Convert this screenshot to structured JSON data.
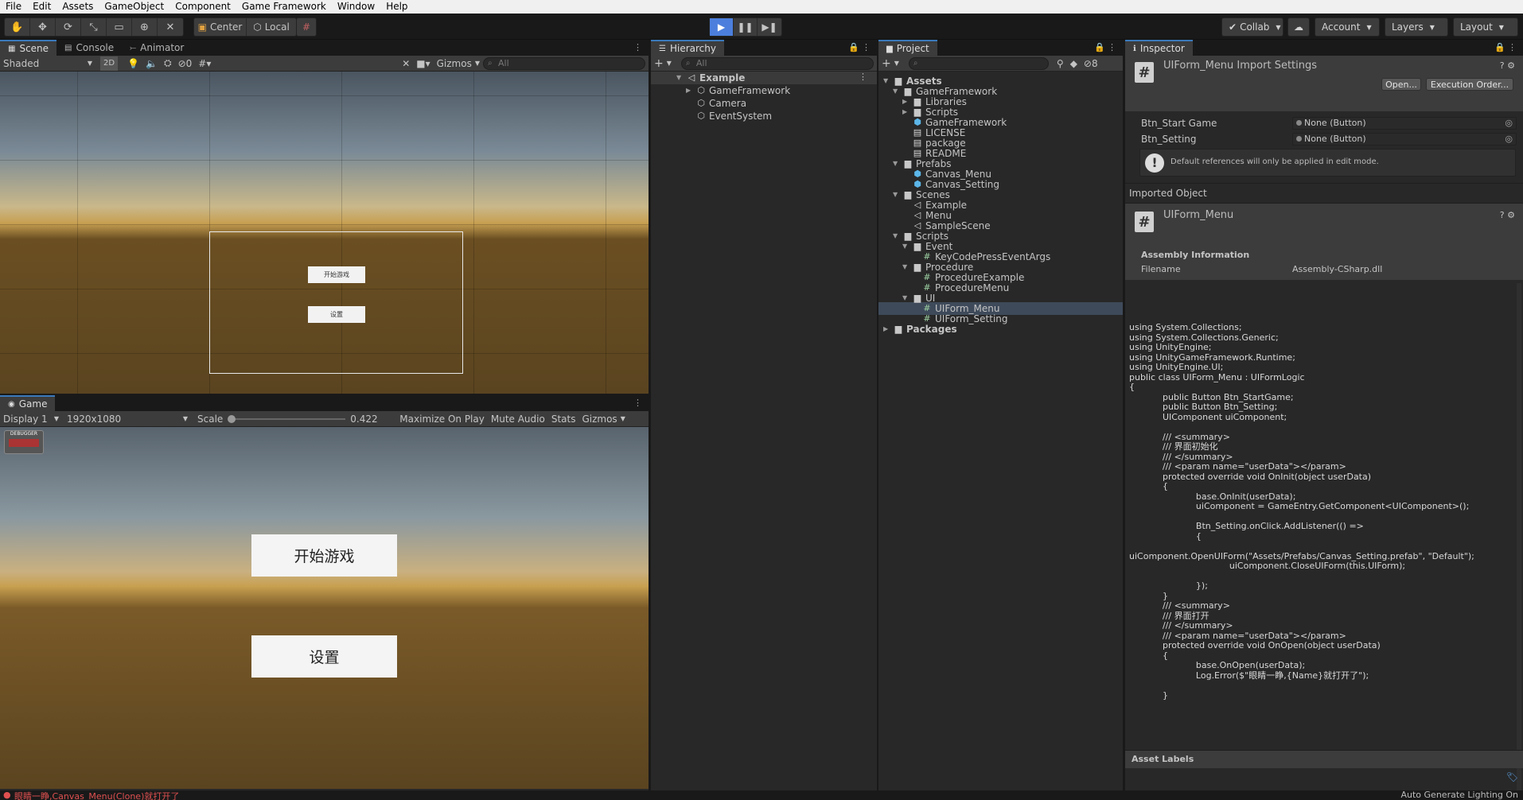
{
  "menu": [
    "File",
    "Edit",
    "Assets",
    "GameObject",
    "Component",
    "Game Framework",
    "Window",
    "Help"
  ],
  "toolbar": {
    "pivot_center": "Center",
    "pivot_local": "Local",
    "collab": "Collab",
    "account": "Account",
    "layers": "Layers",
    "layout": "Layout"
  },
  "scene_panel": {
    "tabs": [
      "Scene",
      "Console",
      "Animator"
    ],
    "shading": "Shaded",
    "mode_2d": "2D",
    "hidden_count": "0",
    "gizmos": "Gizmos",
    "search_placeholder": "All",
    "btn_start_small": "开始游戏",
    "btn_setting_small": "设置"
  },
  "game_panel": {
    "tab": "Game",
    "display": "Display 1",
    "resolution": "1920x1080",
    "scale_label": "Scale",
    "scale_value": "0.422",
    "maximize": "Maximize On Play",
    "mute": "Mute Audio",
    "stats": "Stats",
    "gizmos": "Gizmos",
    "btn_start": "开始游戏",
    "btn_setting": "设置",
    "debugger_label": "DEBUGGER"
  },
  "hierarchy": {
    "tab": "Hierarchy",
    "search_placeholder": "All",
    "scene": "Example",
    "items": [
      "GameFramework",
      "Camera",
      "EventSystem"
    ]
  },
  "project": {
    "tab": "Project",
    "hidden_count": "8",
    "tree": [
      {
        "label": "Assets",
        "bold": true
      },
      {
        "label": "GameFramework"
      },
      {
        "label": "Libraries"
      },
      {
        "label": "Scripts"
      },
      {
        "label": "GameFramework"
      },
      {
        "label": "LICENSE"
      },
      {
        "label": "package"
      },
      {
        "label": "README"
      },
      {
        "label": "Prefabs"
      },
      {
        "label": "Canvas_Menu"
      },
      {
        "label": "Canvas_Setting"
      },
      {
        "label": "Scenes"
      },
      {
        "label": "Example"
      },
      {
        "label": "Menu"
      },
      {
        "label": "SampleScene"
      },
      {
        "label": "Scripts"
      },
      {
        "label": "Event"
      },
      {
        "label": "KeyCodePressEventArgs"
      },
      {
        "label": "Procedure"
      },
      {
        "label": "ProcedureExample"
      },
      {
        "label": "ProcedureMenu"
      },
      {
        "label": "UI"
      },
      {
        "label": "UIForm_Menu",
        "selected": true
      },
      {
        "label": "UIForm_Setting"
      },
      {
        "label": "Packages",
        "bold": true
      }
    ]
  },
  "inspector": {
    "tab": "Inspector",
    "title": "UIForm_Menu Import Settings",
    "open_btn": "Open...",
    "exec_order_btn": "Execution Order...",
    "fields": [
      {
        "label": "Btn_Start Game",
        "value": "None (Button)"
      },
      {
        "label": "Btn_Setting",
        "value": "None (Button)"
      }
    ],
    "help_text": "Default references will only be applied in edit mode.",
    "imported_object": "Imported Object",
    "object_name": "UIForm_Menu",
    "assembly_info": "Assembly Information",
    "filename_label": "Filename",
    "filename_value": "Assembly-CSharp.dll",
    "code": "using System.Collections;\nusing System.Collections.Generic;\nusing UnityEngine;\nusing UnityGameFramework.Runtime;\nusing UnityEngine.UI;\npublic class UIForm_Menu : UIFormLogic\n{\n            public Button Btn_StartGame;\n            public Button Btn_Setting;\n            UIComponent uiComponent;\n\n            /// <summary>\n            /// 界面初始化\n            /// </summary>\n            /// <param name=\"userData\"></param>\n            protected override void OnInit(object userData)\n            {\n                        base.OnInit(userData);\n                        uiComponent = GameEntry.GetComponent<UIComponent>();\n\n                        Btn_Setting.onClick.AddListener(() =>\n                        {\n\nuiComponent.OpenUIForm(\"Assets/Prefabs/Canvas_Setting.prefab\", \"Default\");\n                                    uiComponent.CloseUIForm(this.UIForm);\n\n                        });\n            }\n            /// <summary>\n            /// 界面打开\n            /// </summary>\n            /// <param name=\"userData\"></param>\n            protected override void OnOpen(object userData)\n            {\n                        base.OnOpen(userData);\n                        Log.Error($\"眼睛一睁,{Name}就打开了\");\n\n            }",
    "asset_labels": "Asset Labels"
  },
  "status": {
    "error": "眼睛一睁,Canvas_Menu(Clone)就打开了",
    "right": "Auto Generate Lighting On"
  },
  "colors": {
    "accent": "#3a79bb",
    "play": "#4c7fdd",
    "error": "#e05050"
  }
}
